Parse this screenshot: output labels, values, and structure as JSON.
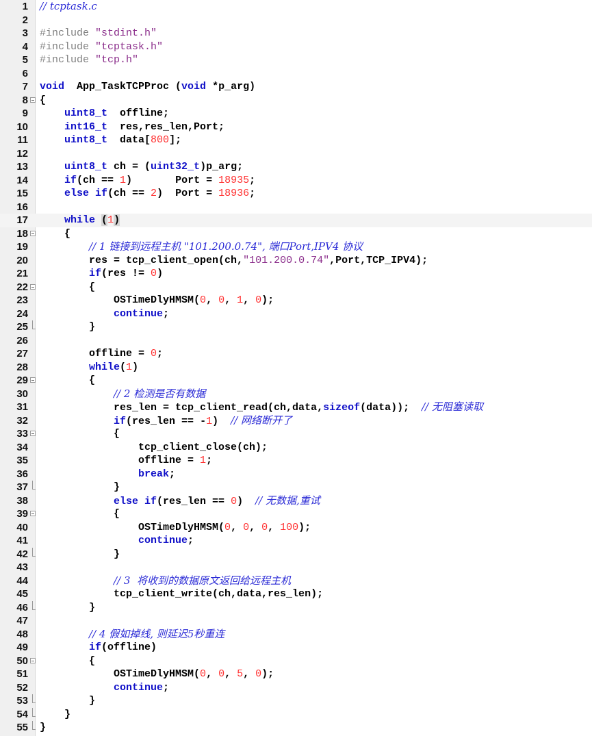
{
  "editor": {
    "current_line": 17,
    "colors": {
      "keyword": "#1010c8",
      "number": "#ff3030",
      "string": "#8b2e8b",
      "comment": "#2b2bd6",
      "preprocessor": "#808080",
      "gutter": "#f0f0f0"
    },
    "fold_marker_lines": [
      8,
      18,
      22,
      29,
      33,
      39,
      50
    ],
    "fold_end_lines": [
      25,
      37,
      42,
      46,
      53,
      54,
      55
    ],
    "lines": [
      {
        "n": "1",
        "tokens": [
          [
            "comment",
            "// tcptask.c"
          ]
        ]
      },
      {
        "n": "2",
        "tokens": []
      },
      {
        "n": "3",
        "tokens": [
          [
            "preproc",
            "#include "
          ],
          [
            "string",
            "\"stdint.h\""
          ]
        ]
      },
      {
        "n": "4",
        "tokens": [
          [
            "preproc",
            "#include "
          ],
          [
            "string",
            "\"tcptask.h\""
          ]
        ]
      },
      {
        "n": "5",
        "tokens": [
          [
            "preproc",
            "#include "
          ],
          [
            "string",
            "\"tcp.h\""
          ]
        ]
      },
      {
        "n": "6",
        "tokens": []
      },
      {
        "n": "7",
        "tokens": [
          [
            "keyword",
            "void"
          ],
          [
            "plain",
            "  App_TaskTCPProc ("
          ],
          [
            "keyword",
            "void"
          ],
          [
            "plain",
            " *p_arg)"
          ]
        ]
      },
      {
        "n": "8",
        "tokens": [
          [
            "plain",
            "{"
          ]
        ]
      },
      {
        "n": "9",
        "tokens": [
          [
            "plain",
            "    "
          ],
          [
            "keyword",
            "uint8_t"
          ],
          [
            "plain",
            "  offline;"
          ]
        ]
      },
      {
        "n": "10",
        "tokens": [
          [
            "plain",
            "    "
          ],
          [
            "keyword",
            "int16_t"
          ],
          [
            "plain",
            "  res,res_len,Port;"
          ]
        ]
      },
      {
        "n": "11",
        "tokens": [
          [
            "plain",
            "    "
          ],
          [
            "keyword",
            "uint8_t"
          ],
          [
            "plain",
            "  data["
          ],
          [
            "number",
            "800"
          ],
          [
            "plain",
            "];"
          ]
        ]
      },
      {
        "n": "12",
        "tokens": []
      },
      {
        "n": "13",
        "tokens": [
          [
            "plain",
            "    "
          ],
          [
            "keyword",
            "uint8_t"
          ],
          [
            "plain",
            " ch = ("
          ],
          [
            "keyword",
            "uint32_t"
          ],
          [
            "plain",
            ")p_arg;"
          ]
        ]
      },
      {
        "n": "14",
        "tokens": [
          [
            "plain",
            "    "
          ],
          [
            "keyword",
            "if"
          ],
          [
            "plain",
            "(ch == "
          ],
          [
            "number",
            "1"
          ],
          [
            "plain",
            ")       Port = "
          ],
          [
            "number",
            "18935"
          ],
          [
            "plain",
            ";"
          ]
        ]
      },
      {
        "n": "15",
        "tokens": [
          [
            "plain",
            "    "
          ],
          [
            "keyword",
            "else if"
          ],
          [
            "plain",
            "(ch == "
          ],
          [
            "number",
            "2"
          ],
          [
            "plain",
            ")  Port = "
          ],
          [
            "number",
            "18936"
          ],
          [
            "plain",
            ";"
          ]
        ]
      },
      {
        "n": "16",
        "tokens": []
      },
      {
        "n": "17",
        "tokens": [
          [
            "plain",
            "    "
          ],
          [
            "keyword",
            "while"
          ],
          [
            "plain",
            " "
          ],
          [
            "parenhl",
            "("
          ],
          [
            "number",
            "1"
          ],
          [
            "parenhl",
            ")"
          ]
        ]
      },
      {
        "n": "18",
        "tokens": [
          [
            "plain",
            "    {"
          ]
        ]
      },
      {
        "n": "19",
        "tokens": [
          [
            "plain",
            "        "
          ],
          [
            "comment",
            "// 1 链接到远程主机 \"101.200.0.74\", 端口Port,IPV4 协议"
          ]
        ]
      },
      {
        "n": "20",
        "tokens": [
          [
            "plain",
            "        res = tcp_client_open(ch,"
          ],
          [
            "string",
            "\"101.200.0.74\""
          ],
          [
            "plain",
            ",Port,TCP_IPV4);"
          ]
        ]
      },
      {
        "n": "21",
        "tokens": [
          [
            "plain",
            "        "
          ],
          [
            "keyword",
            "if"
          ],
          [
            "plain",
            "(res != "
          ],
          [
            "number",
            "0"
          ],
          [
            "plain",
            ")"
          ]
        ]
      },
      {
        "n": "22",
        "tokens": [
          [
            "plain",
            "        {"
          ]
        ]
      },
      {
        "n": "23",
        "tokens": [
          [
            "plain",
            "            OSTimeDlyHMSM("
          ],
          [
            "number",
            "0"
          ],
          [
            "plain",
            ", "
          ],
          [
            "number",
            "0"
          ],
          [
            "plain",
            ", "
          ],
          [
            "number",
            "1"
          ],
          [
            "plain",
            ", "
          ],
          [
            "number",
            "0"
          ],
          [
            "plain",
            ");"
          ]
        ]
      },
      {
        "n": "24",
        "tokens": [
          [
            "plain",
            "            "
          ],
          [
            "keyword",
            "continue"
          ],
          [
            "plain",
            ";"
          ]
        ]
      },
      {
        "n": "25",
        "tokens": [
          [
            "plain",
            "        }"
          ]
        ]
      },
      {
        "n": "26",
        "tokens": []
      },
      {
        "n": "27",
        "tokens": [
          [
            "plain",
            "        offline = "
          ],
          [
            "number",
            "0"
          ],
          [
            "plain",
            ";"
          ]
        ]
      },
      {
        "n": "28",
        "tokens": [
          [
            "plain",
            "        "
          ],
          [
            "keyword",
            "while"
          ],
          [
            "plain",
            "("
          ],
          [
            "number",
            "1"
          ],
          [
            "plain",
            ")"
          ]
        ]
      },
      {
        "n": "29",
        "tokens": [
          [
            "plain",
            "        {"
          ]
        ]
      },
      {
        "n": "30",
        "tokens": [
          [
            "plain",
            "            "
          ],
          [
            "comment",
            "// 2 检测是否有数据"
          ]
        ]
      },
      {
        "n": "31",
        "tokens": [
          [
            "plain",
            "            res_len = tcp_client_read(ch,data,"
          ],
          [
            "keyword",
            "sizeof"
          ],
          [
            "plain",
            "(data));  "
          ],
          [
            "comment",
            "// 无阻塞读取"
          ]
        ]
      },
      {
        "n": "32",
        "tokens": [
          [
            "plain",
            "            "
          ],
          [
            "keyword",
            "if"
          ],
          [
            "plain",
            "(res_len == -"
          ],
          [
            "number",
            "1"
          ],
          [
            "plain",
            ")  "
          ],
          [
            "comment",
            "// 网络断开了"
          ]
        ]
      },
      {
        "n": "33",
        "tokens": [
          [
            "plain",
            "            {"
          ]
        ]
      },
      {
        "n": "34",
        "tokens": [
          [
            "plain",
            "                tcp_client_close(ch);"
          ]
        ]
      },
      {
        "n": "35",
        "tokens": [
          [
            "plain",
            "                offline = "
          ],
          [
            "number",
            "1"
          ],
          [
            "plain",
            ";"
          ]
        ]
      },
      {
        "n": "36",
        "tokens": [
          [
            "plain",
            "                "
          ],
          [
            "keyword",
            "break"
          ],
          [
            "plain",
            ";"
          ]
        ]
      },
      {
        "n": "37",
        "tokens": [
          [
            "plain",
            "            }"
          ]
        ]
      },
      {
        "n": "38",
        "tokens": [
          [
            "plain",
            "            "
          ],
          [
            "keyword",
            "else if"
          ],
          [
            "plain",
            "(res_len == "
          ],
          [
            "number",
            "0"
          ],
          [
            "plain",
            ")  "
          ],
          [
            "comment",
            "// 无数据,重试"
          ]
        ]
      },
      {
        "n": "39",
        "tokens": [
          [
            "plain",
            "            {"
          ]
        ]
      },
      {
        "n": "40",
        "tokens": [
          [
            "plain",
            "                OSTimeDlyHMSM("
          ],
          [
            "number",
            "0"
          ],
          [
            "plain",
            ", "
          ],
          [
            "number",
            "0"
          ],
          [
            "plain",
            ", "
          ],
          [
            "number",
            "0"
          ],
          [
            "plain",
            ", "
          ],
          [
            "number",
            "100"
          ],
          [
            "plain",
            ");"
          ]
        ]
      },
      {
        "n": "41",
        "tokens": [
          [
            "plain",
            "                "
          ],
          [
            "keyword",
            "continue"
          ],
          [
            "plain",
            ";"
          ]
        ]
      },
      {
        "n": "42",
        "tokens": [
          [
            "plain",
            "            }"
          ]
        ]
      },
      {
        "n": "43",
        "tokens": []
      },
      {
        "n": "44",
        "tokens": [
          [
            "plain",
            "            "
          ],
          [
            "comment",
            "// 3  将收到的数据原文返回给远程主机"
          ]
        ]
      },
      {
        "n": "45",
        "tokens": [
          [
            "plain",
            "            tcp_client_write(ch,data,res_len);"
          ]
        ]
      },
      {
        "n": "46",
        "tokens": [
          [
            "plain",
            "        }"
          ]
        ]
      },
      {
        "n": "47",
        "tokens": []
      },
      {
        "n": "48",
        "tokens": [
          [
            "plain",
            "        "
          ],
          [
            "comment",
            "// 4 假如掉线, 则延迟5秒重连"
          ]
        ]
      },
      {
        "n": "49",
        "tokens": [
          [
            "plain",
            "        "
          ],
          [
            "keyword",
            "if"
          ],
          [
            "plain",
            "(offline)"
          ]
        ]
      },
      {
        "n": "50",
        "tokens": [
          [
            "plain",
            "        {"
          ]
        ]
      },
      {
        "n": "51",
        "tokens": [
          [
            "plain",
            "            OSTimeDlyHMSM("
          ],
          [
            "number",
            "0"
          ],
          [
            "plain",
            ", "
          ],
          [
            "number",
            "0"
          ],
          [
            "plain",
            ", "
          ],
          [
            "number",
            "5"
          ],
          [
            "plain",
            ", "
          ],
          [
            "number",
            "0"
          ],
          [
            "plain",
            ");"
          ]
        ]
      },
      {
        "n": "52",
        "tokens": [
          [
            "plain",
            "            "
          ],
          [
            "keyword",
            "continue"
          ],
          [
            "plain",
            ";"
          ]
        ]
      },
      {
        "n": "53",
        "tokens": [
          [
            "plain",
            "        }"
          ]
        ]
      },
      {
        "n": "54",
        "tokens": [
          [
            "plain",
            "    }"
          ]
        ]
      },
      {
        "n": "55",
        "tokens": [
          [
            "plain",
            "}"
          ]
        ]
      }
    ]
  }
}
